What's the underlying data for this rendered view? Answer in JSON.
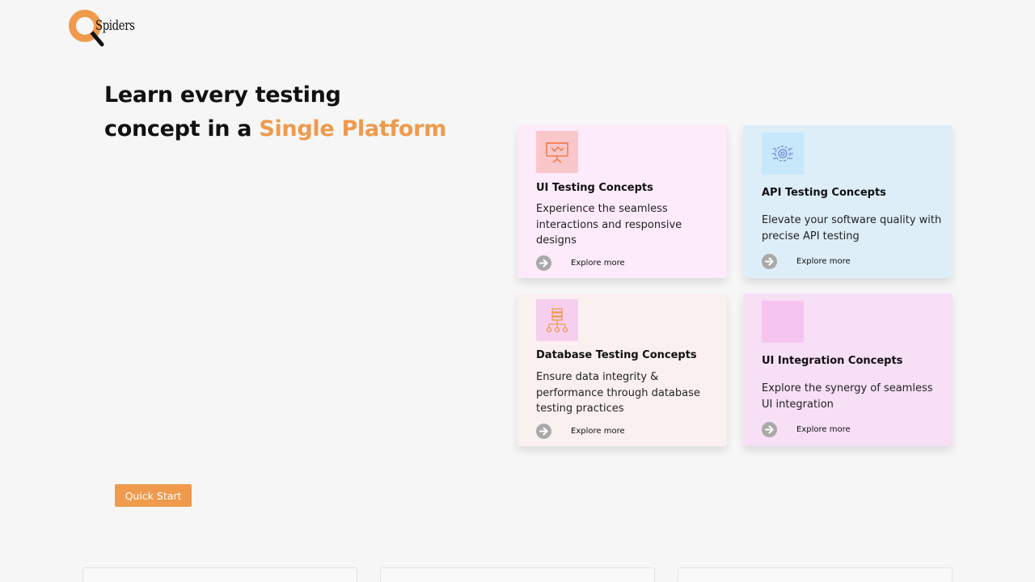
{
  "logo": {
    "text": "Spiders"
  },
  "hero": {
    "line1": "Learn every testing",
    "line2_prefix": "concept in a ",
    "line2_accent": "Single Platform"
  },
  "cards": [
    {
      "title": "UI Testing Concepts",
      "description": "Experience the seamless interactions and responsive designs",
      "explore": "Explore more",
      "icon": "presentation-board-icon"
    },
    {
      "title": "API Testing Concepts",
      "description": "Elevate your software quality with precise API testing",
      "explore": "Explore more",
      "icon": "gear-network-icon"
    },
    {
      "title": "Database Testing Concepts",
      "description": "Ensure data integrity & performance through database testing practices",
      "explore": "Explore more",
      "icon": "database-hierarchy-icon"
    },
    {
      "title": "UI Integration Concepts",
      "description": "Explore the synergy of seamless UI integration",
      "explore": "Explore more",
      "icon": "blank-icon"
    }
  ],
  "quick_start": {
    "label": "Quick Start"
  },
  "colors": {
    "accent": "#ef9a4c",
    "background": "#f6f6f6",
    "card_ui": "#fdeafa",
    "card_api": "#ddeef8",
    "card_db": "#fbf0f0",
    "card_integration": "#f7dff5"
  }
}
